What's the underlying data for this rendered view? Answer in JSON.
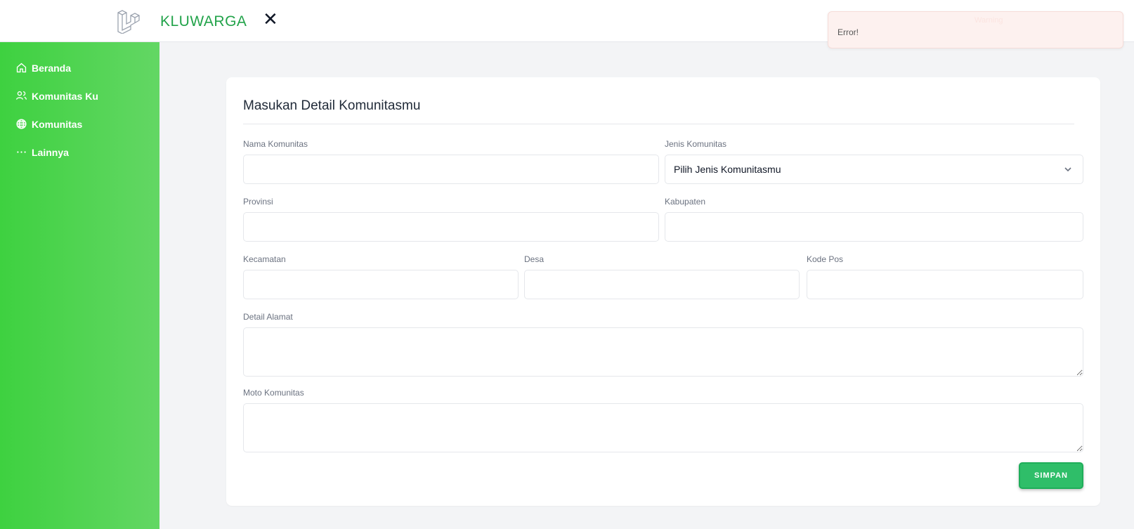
{
  "header": {
    "brand": "KLUWARGA",
    "close_symbol": "✕",
    "logo_icon": "laravel-logo-icon",
    "brand_color": "#22a34a"
  },
  "toast": {
    "title": "Warning",
    "message": "Error!",
    "background": "#fdf1ef"
  },
  "sidebar": {
    "background": "#3ed140",
    "items": [
      {
        "label": "Beranda",
        "icon": "home-icon"
      },
      {
        "label": "Komunitas Ku",
        "icon": "users-icon"
      },
      {
        "label": "Komunitas",
        "icon": "globe-icon"
      },
      {
        "label": "Lainnya",
        "icon": "dots-icon"
      }
    ]
  },
  "form": {
    "title": "Masukan Detail Komunitasmu",
    "fields": {
      "nama_komunitas": {
        "label": "Nama Komunitas",
        "value": ""
      },
      "jenis_komunitas": {
        "label": "Jenis Komunitas",
        "selected": "Pilih Jenis Komunitasmu"
      },
      "provinsi": {
        "label": "Provinsi",
        "value": ""
      },
      "kabupaten": {
        "label": "Kabupaten",
        "value": ""
      },
      "kecamatan": {
        "label": "Kecamatan",
        "value": ""
      },
      "desa": {
        "label": "Desa",
        "value": ""
      },
      "kode_pos": {
        "label": "Kode Pos",
        "value": ""
      },
      "detail_alamat": {
        "label": "Detail Alamat",
        "value": ""
      },
      "moto_komunitas": {
        "label": "Moto Komunitas",
        "value": ""
      }
    },
    "submit_label": "SIMPAN",
    "submit_color": "#2fbe69"
  }
}
